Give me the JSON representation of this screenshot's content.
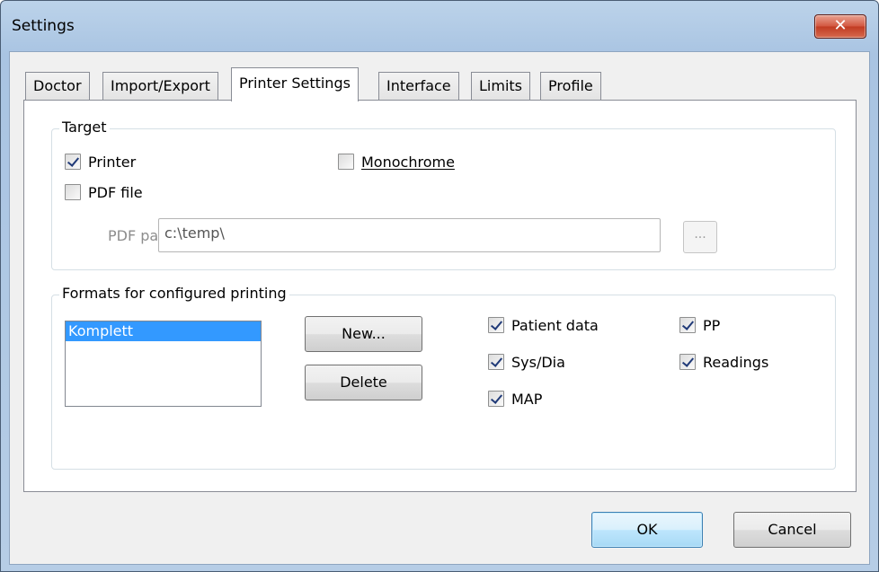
{
  "window": {
    "title": "Settings",
    "close_glyph": "✕"
  },
  "tabs": [
    {
      "label": "Doctor",
      "active": false
    },
    {
      "label": "Import/Export",
      "active": false
    },
    {
      "label": "Printer Settings",
      "active": true
    },
    {
      "label": "Interface",
      "active": false
    },
    {
      "label": "Limits",
      "active": false
    },
    {
      "label": "Profile",
      "active": false
    }
  ],
  "target": {
    "group_label": "Target",
    "printer": {
      "label": "Printer",
      "checked": true
    },
    "monochrome": {
      "label": "Monochrome",
      "checked": false
    },
    "pdf_file": {
      "label": "PDF file",
      "checked": false
    },
    "pdf_path": {
      "label": "PDF path",
      "value": "c:\\temp\\",
      "browse_label": "..."
    }
  },
  "formats": {
    "group_label": "Formats for configured printing",
    "list_items": [
      "Komplett"
    ],
    "selected_item": "Komplett",
    "new_button": "New...",
    "delete_button": "Delete",
    "options": {
      "patient_data": {
        "label": "Patient data",
        "checked": true
      },
      "sys_dia": {
        "label": "Sys/Dia",
        "checked": true
      },
      "map": {
        "label": "MAP",
        "checked": true
      },
      "pp": {
        "label": "PP",
        "checked": true
      },
      "readings": {
        "label": "Readings",
        "checked": true
      }
    }
  },
  "footer": {
    "ok_label": "OK",
    "cancel_label": "Cancel"
  }
}
